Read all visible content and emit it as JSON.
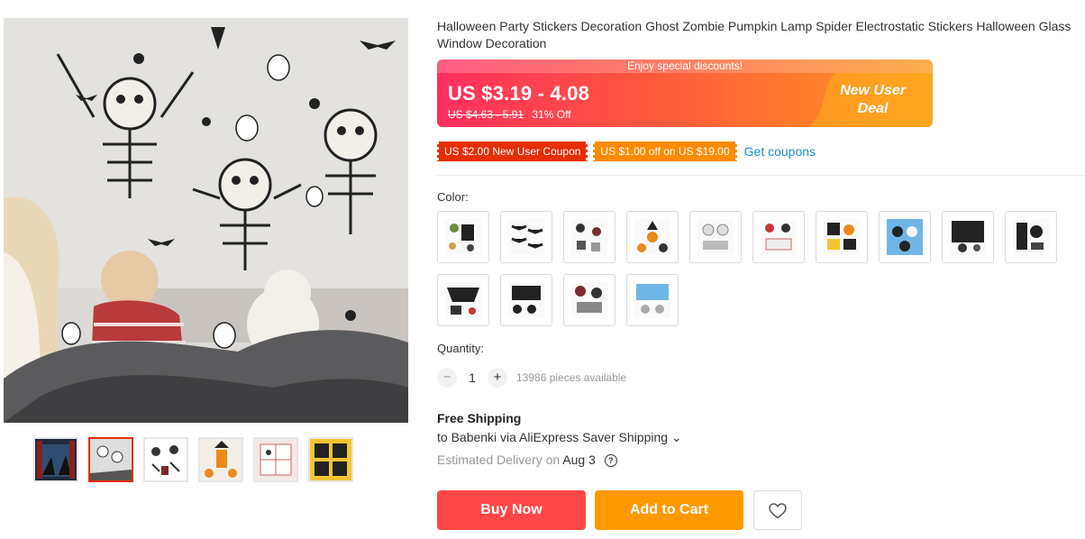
{
  "product": {
    "title": "Halloween Party Stickers Decoration Ghost Zombie Pumpkin Lamp Spider Electrostatic Stickers Halloween Glass Window Decoration"
  },
  "price": {
    "discount_strip": "Enjoy special discounts!",
    "current": "US $3.19 - 4.08",
    "original": "US $4.63 - 5.91",
    "off": "31% Off",
    "deal_line1": "New User",
    "deal_line2": "Deal"
  },
  "coupons": {
    "coupon1": "US $2.00 New User Coupon",
    "coupon2": "US $1.00 off on US $19.00",
    "get_link": "Get coupons"
  },
  "color": {
    "label": "Color:",
    "swatch_count": 14
  },
  "quantity": {
    "label": "Quantity:",
    "minus": "−",
    "value": "1",
    "plus": "+",
    "available": "13986 pieces available"
  },
  "shipping": {
    "title": "Free Shipping",
    "detail": "to Babenki via AliExpress Saver Shipping ⌄",
    "eta_label": "Estimated Delivery on",
    "eta_date": "Aug 3",
    "help": "?"
  },
  "actions": {
    "buy_now": "Buy Now",
    "add_to_cart": "Add to Cart"
  },
  "colors": {
    "accent_red": "#ff4747",
    "accent_orange": "#ff9900",
    "link_blue": "#1a8ccf"
  }
}
